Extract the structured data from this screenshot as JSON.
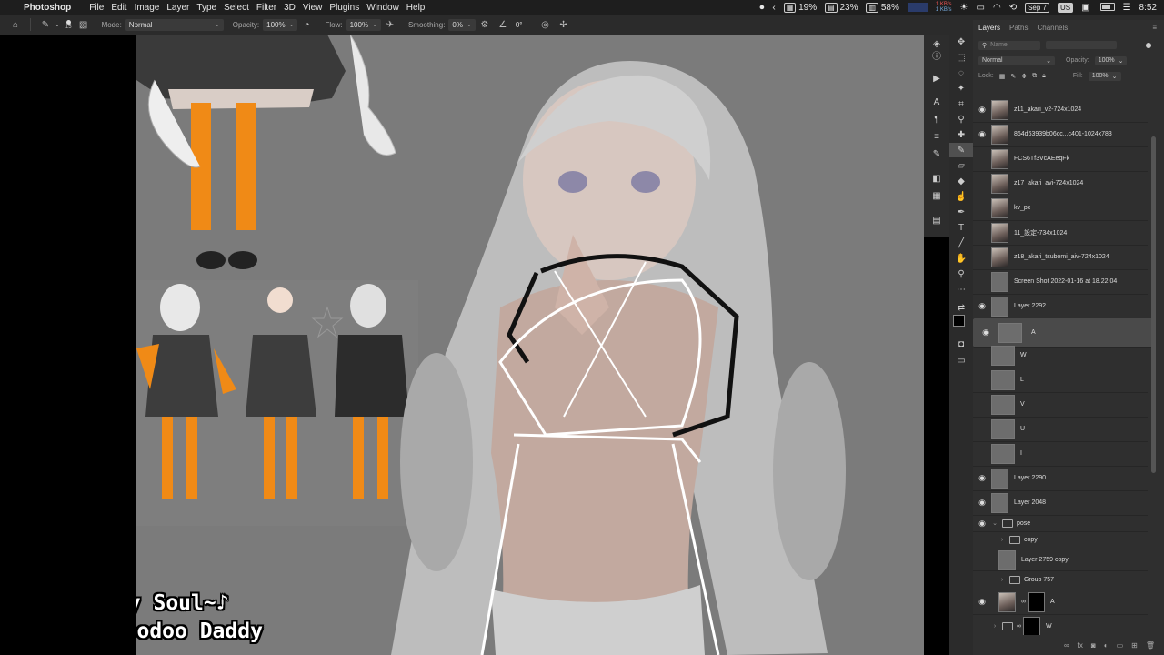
{
  "menubar": {
    "app": "Photoshop",
    "items": [
      "File",
      "Edit",
      "Image",
      "Layer",
      "Type",
      "Select",
      "Filter",
      "3D",
      "View",
      "Plugins",
      "Window",
      "Help"
    ],
    "status": {
      "cpu": "19%",
      "mem": "23%",
      "disk": "58%",
      "net_up": "1 KB/s",
      "net_down": "1 KB/s",
      "date": "Sep 7",
      "input": "US",
      "time": "8:52"
    }
  },
  "options": {
    "brush_size": "15",
    "mode_label": "Mode:",
    "mode_value": "Normal",
    "opacity_label": "Opacity:",
    "opacity_value": "100%",
    "flow_label": "Flow:",
    "flow_value": "100%",
    "smoothing_label": "Smoothing:",
    "smoothing_value": "0%",
    "angle_value": "0°"
  },
  "panel": {
    "tabs": [
      "Layers",
      "Paths",
      "Channels"
    ],
    "search_placeholder": "Name",
    "blend_mode": "Normal",
    "opacity_label": "Opacity:",
    "opacity_value": "100%",
    "lock_label": "Lock:",
    "fill_label": "Fill:",
    "fill_value": "100%",
    "layers": [
      {
        "name": "z11_akari_v2-724x1024",
        "visible": true,
        "thumb": "img"
      },
      {
        "name": "864d63939b06cc...c401-1024x783",
        "visible": true,
        "thumb": "img"
      },
      {
        "name": "FCS6Tf3VcAEeqFk",
        "visible": false,
        "thumb": "img"
      },
      {
        "name": "z17_akari_avi-724x1024",
        "visible": false,
        "thumb": "img"
      },
      {
        "name": "kv_pc",
        "visible": false,
        "thumb": "img"
      },
      {
        "name": "11_設定-734x1024",
        "visible": false,
        "thumb": "img"
      },
      {
        "name": "z18_akari_tsubomi_aiv-724x1024",
        "visible": false,
        "thumb": "img"
      },
      {
        "name": "Screen Shot 2022-01-16 at 18.22.04",
        "visible": false,
        "thumb": "gry"
      },
      {
        "name": "Layer 2292",
        "visible": true,
        "thumb": "gry"
      },
      {
        "name": "A",
        "visible": true,
        "thumb": "gry",
        "selected": true
      },
      {
        "name": "W",
        "visible": false,
        "thumb": "gry"
      },
      {
        "name": "L",
        "visible": false,
        "thumb": "gry"
      },
      {
        "name": "V",
        "visible": false,
        "thumb": "gry"
      },
      {
        "name": "U",
        "visible": false,
        "thumb": "gry"
      },
      {
        "name": "I",
        "visible": false,
        "thumb": "gry"
      },
      {
        "name": "Layer 2290",
        "visible": true,
        "thumb": "gry"
      },
      {
        "name": "Layer 2048",
        "visible": true,
        "thumb": "gry"
      }
    ],
    "pose_group": "pose",
    "pose_children": [
      "copy",
      "Layer 2759 copy",
      "Group 757"
    ],
    "bottom_layers": [
      "A",
      "W"
    ]
  },
  "overlay": {
    "line1": "♪~Save My Soul~♪",
    "line2": "Big Bad Voodoo Daddy"
  },
  "colors": {
    "canvas_bg": "#7b7b7b",
    "panel_bg": "#2f2f2f",
    "toolbar_bg": "#2b2b2b"
  }
}
